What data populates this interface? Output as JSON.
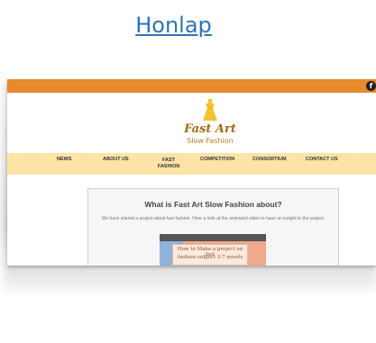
{
  "header": {
    "link_text": "Honlap"
  },
  "site": {
    "logo": {
      "title": "Fast Art",
      "subtitle": "Slow Fashion"
    },
    "social_icon": "facebook-icon",
    "social_glyph": "f",
    "colors": {
      "topbar": "#e8892b",
      "nav": "#fbe4a6",
      "brand": "#a66a12"
    },
    "nav": [
      {
        "label": "NEWS"
      },
      {
        "label": "ABOUT US"
      },
      {
        "line1": "FAST",
        "line2": "FASHION"
      },
      {
        "label": "COMPETITION"
      },
      {
        "label": "CONSORTIUM"
      },
      {
        "label": "CONTACT US"
      }
    ],
    "card": {
      "title": "What is Fast Art Slow Fashion about?",
      "text": "We have started a project about fast fashion. Here a look at the animated video to have an insight to the project.",
      "video_line1": "How to Make a project on fast",
      "video_line2": "fashion subject 3-7 novels"
    }
  }
}
